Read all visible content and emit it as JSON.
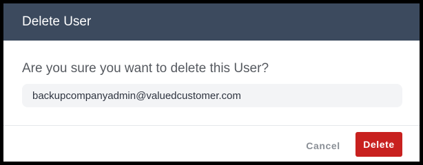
{
  "dialog": {
    "title": "Delete User",
    "question": "Are you sure you want to delete this User?",
    "target_value": "backupcompanyadmin@valuedcustomer.com"
  },
  "footer": {
    "cancel_label": "Cancel",
    "delete_label": "Delete"
  },
  "colors": {
    "header_bg": "#3c4a5e",
    "danger": "#c8211f",
    "muted_text": "#8a8f96"
  }
}
